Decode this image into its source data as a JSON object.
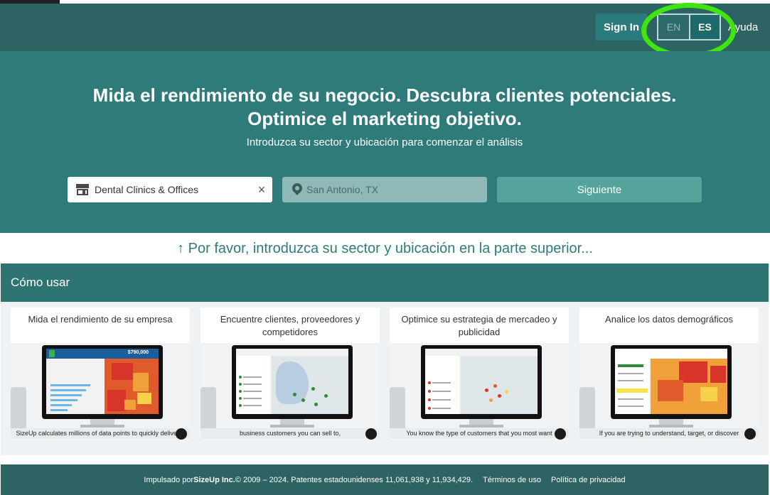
{
  "header": {
    "sign_in_label": "Sign In",
    "lang_en_label": "EN",
    "lang_es_label": "ES",
    "help_label": "Ayuda"
  },
  "hero": {
    "title_line1": "Mida el rendimiento de su negocio. Descubra clientes potenciales.",
    "title_line2": "Optimice el marketing objetivo.",
    "subtitle": "Introduzca su sector y ubicación para comenzar el análisis",
    "industry_value": "Dental Clinics & Offices",
    "clear_glyph": "×",
    "location_placeholder": "San Antonio, TX",
    "next_label": "Siguiente"
  },
  "prompt": "↑ Por favor, introduzca su sector y ubicación en la parte superior...",
  "howto": {
    "title": "Cómo usar",
    "cards": [
      {
        "title": "Mida el rendimiento de su empresa",
        "caption": "SizeUp calculates millions of data points to quickly deliver a",
        "screen_price": "$790,000"
      },
      {
        "title": "Encuentre clientes, proveedores y competidores",
        "caption": "business customers you can sell to,"
      },
      {
        "title": "Optimice su estrategia de mercadeo y publicidad",
        "caption": "You know the type of customers that you most want"
      },
      {
        "title": "Analice los datos demográficos",
        "caption": "If you are trying to understand, target, or discover"
      }
    ]
  },
  "footer": {
    "powered_prefix": "Impulsado por ",
    "company": "SizeUp Inc.",
    "copyright": " © 2009 – 2024. Patentes estadounidenses 11,061,938 y 11,934,429.",
    "terms_label": "Términos de uso",
    "privacy_label": "Política de privacidad"
  },
  "colors": {
    "header_bg": "#2d6363",
    "hero_bg": "#2e7b7a",
    "accent_button": "#54a49c",
    "highlight_ring": "#3ee60d"
  },
  "icons": [
    "store-icon",
    "close-icon",
    "location-pin-icon",
    "up-arrow-icon"
  ]
}
